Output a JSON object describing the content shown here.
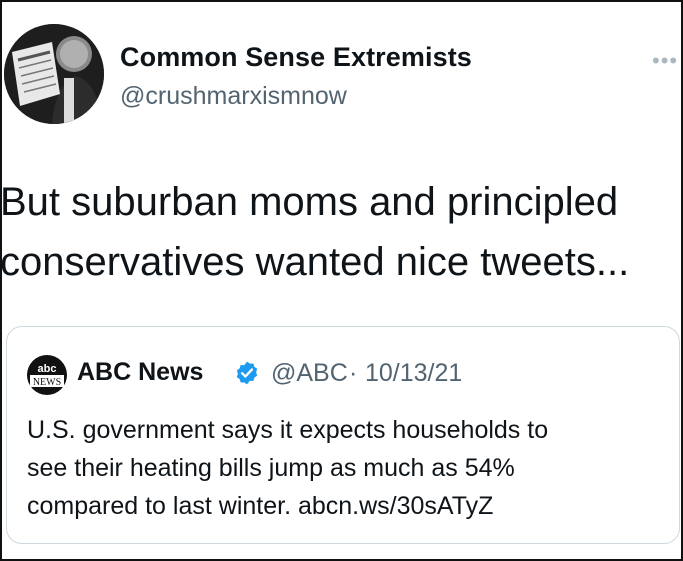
{
  "tweet": {
    "author": {
      "display_name": "Common Sense Extremists",
      "handle": "@crushmarxismnow",
      "avatar_icon": "avatar-man-reading-newspaper"
    },
    "more_icon": "more-dots-icon",
    "more_glyph": "•••",
    "text": "But suburban moms and principled\nconservatives wanted nice tweets..."
  },
  "quoted_tweet": {
    "logo_icon": "abc-news-logo",
    "display_name": "ABC News",
    "verified_icon": "verified-badge-icon",
    "handle": "@ABC",
    "separator": "·",
    "date": "10/13/21",
    "text": "U.S. government says it expects households to\nsee their heating bills jump as much as 54%\ncompared to last winter. abcn.ws/30sATyZ"
  },
  "colors": {
    "text": "#0f1419",
    "secondary": "#536471",
    "verified": "#1d9bf0",
    "border": "#cfd9de"
  }
}
